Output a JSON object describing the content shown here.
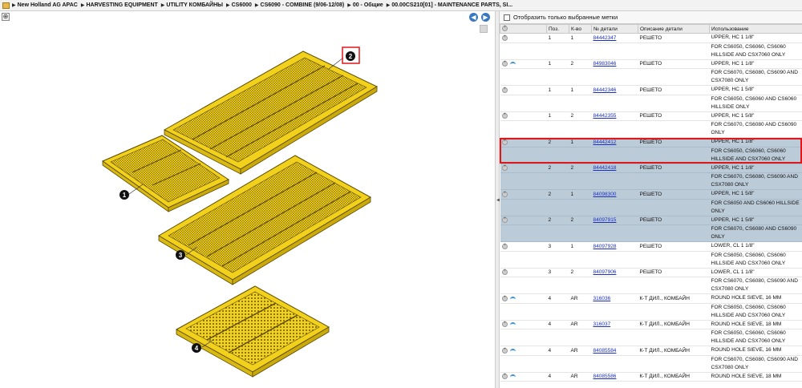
{
  "breadcrumb": {
    "items": [
      "New Holland AG APAC",
      "HARVESTING EQUIPMENT",
      "UTILITY КОМБАЙНЫ",
      "CS6000",
      "CS6090 - COMBINE (9/06-12/08)",
      "00 - Общие",
      "00.00CS210[01] - MAINTENANCE PARTS, SI..."
    ]
  },
  "diagram": {
    "callouts": [
      "1",
      "2",
      "3",
      "4"
    ],
    "highlighted_callout": "2",
    "nav_back": "◀",
    "nav_forward": "▶",
    "tool": "⊕",
    "colors": {
      "part": "#f2d11c",
      "outline": "#5c4a00",
      "highlight": "#e0161b"
    }
  },
  "parts": {
    "filter_label": "Отобразить только выбранные метки",
    "columns": [
      "",
      "Поз.",
      "К-во",
      "№ детали",
      "Описание детали",
      "Использование"
    ],
    "rows": [
      {
        "pos": "1",
        "qty": "1",
        "pn": "84442347",
        "desc": "РЕШЕТО",
        "use": [
          "UPPER, HC 1 1/8\"",
          "FOR CS6050, CS6060, CS6060 HILLSIDE AND CSX7060 ONLY"
        ],
        "link": false,
        "hl": false
      },
      {
        "pos": "1",
        "qty": "2",
        "pn": "84983046",
        "desc": "РЕШЕТО",
        "use": [
          "UPPER, HC 1 1/8\"",
          "FOR CS6070, CS6080, CS6090 AND CSX7080 ONLY"
        ],
        "link": true,
        "hl": false
      },
      {
        "pos": "1",
        "qty": "1",
        "pn": "84442346",
        "desc": "РЕШЕТО",
        "use": [
          "UPPER, HC 1 5/8\"",
          "FOR CS6050, CS6060 AND CS6060 HILLSIDE ONLY"
        ],
        "link": false,
        "hl": false
      },
      {
        "pos": "1",
        "qty": "2",
        "pn": "84442355",
        "desc": "РЕШЕТО",
        "use": [
          "UPPER, HC 1 5/8\"",
          "FOR CS6070, CS6080 AND CS6090 ONLY"
        ],
        "link": false,
        "hl": false
      },
      {
        "pos": "2",
        "qty": "1",
        "pn": "84442412",
        "desc": "РЕШЕТО",
        "use": [
          "UPPER, HC 1 1/8\"",
          "FOR CS6050, CS6060, CS6060 HILLSIDE AND CSX7060 ONLY"
        ],
        "link": false,
        "hl": true,
        "selected": true
      },
      {
        "pos": "2",
        "qty": "2",
        "pn": "84442418",
        "desc": "РЕШЕТО",
        "use": [
          "UPPER, HC 1 1/8\"",
          "FOR CS6070, CS6080, CS6090 AND CSX7080 ONLY"
        ],
        "link": false,
        "hl": true
      },
      {
        "pos": "2",
        "qty": "1",
        "pn": "84098300",
        "desc": "РЕШЕТО",
        "use": [
          "UPPER, HC 1 5/8\"",
          "FOR CS6050 AND CS6060 HILLSIDE ONLY"
        ],
        "link": false,
        "hl": true
      },
      {
        "pos": "2",
        "qty": "2",
        "pn": "84097915",
        "desc": "РЕШЕТО",
        "use": [
          "UPPER, HC 1 5/8\"",
          "FOR CS6070, CS6080 AND CS6090 ONLY"
        ],
        "link": false,
        "hl": true
      },
      {
        "pos": "3",
        "qty": "1",
        "pn": "84097928",
        "desc": "РЕШЕТО",
        "use": [
          "LOWER, CL 1 1/8\"",
          "FOR CS6050, CS6060, CS6060 HILLSIDE AND CSX7060 ONLY"
        ],
        "link": false,
        "hl": false
      },
      {
        "pos": "3",
        "qty": "2",
        "pn": "84097906",
        "desc": "РЕШЕТО",
        "use": [
          "LOWER, CL 1 1/8\"",
          "FOR CS6070, CS6080, CS6090 AND CSX7080 ONLY"
        ],
        "link": false,
        "hl": false
      },
      {
        "pos": "4",
        "qty": "AR",
        "pn": "316036",
        "desc": "К-Т ДИЛ., КОМБАЙН",
        "use": [
          "ROUND HOLE SIEVE, 16 MM",
          "FOR CS6050, CS6060, CS6060 HILLSIDE AND CSX7060 ONLY"
        ],
        "link": true,
        "hl": false
      },
      {
        "pos": "4",
        "qty": "AR",
        "pn": "316037",
        "desc": "К-Т ДИЛ., КОМБАЙН",
        "use": [
          "ROUND HOLE SIEVE, 18 MM",
          "FOR CS6050, CS6060, CS6060 HILLSIDE AND CSX7060 ONLY"
        ],
        "link": true,
        "hl": false
      },
      {
        "pos": "4",
        "qty": "AR",
        "pn": "84085584",
        "desc": "К-Т ДИЛ., КОМБАЙН",
        "use": [
          "ROUND HOLE SIEVE, 16 MM",
          "FOR CS6070, CS6080, CS6090 AND CSX7080 ONLY"
        ],
        "link": true,
        "hl": false
      },
      {
        "pos": "4",
        "qty": "AR",
        "pn": "84085586",
        "desc": "К-Т ДИЛ., КОМБАЙН",
        "use": [
          "ROUND HOLE SIEVE, 18 MM"
        ],
        "link": true,
        "hl": false
      }
    ]
  }
}
